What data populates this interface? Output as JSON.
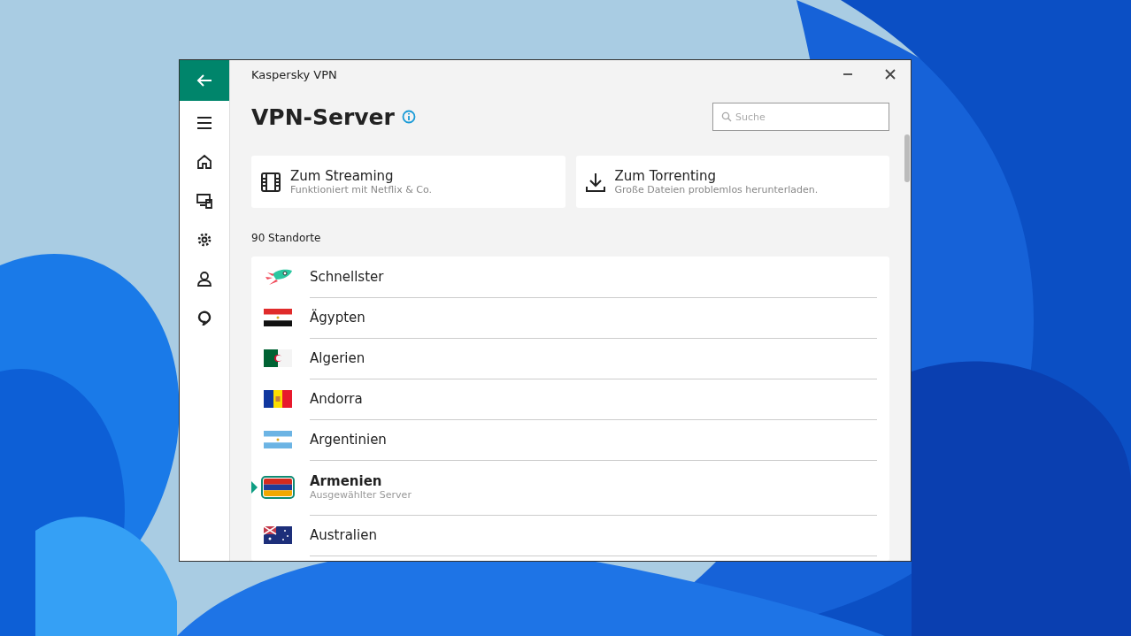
{
  "window": {
    "title": "Kaspersky VPN"
  },
  "page": {
    "title": "VPN-Server"
  },
  "search": {
    "placeholder": "Suche"
  },
  "cards": [
    {
      "kind": "film",
      "title": "Zum Streaming",
      "subtitle": "Funktioniert mit Netflix & Co."
    },
    {
      "kind": "download",
      "title": "Zum Torrenting",
      "subtitle": "Große Dateien problemlos herunterladen."
    }
  ],
  "locations": {
    "count_label": "90 Standorte",
    "rows": [
      {
        "kind": "rocket",
        "name": "Schnellster",
        "selected": false
      },
      {
        "kind": "flag",
        "name": "Ägypten",
        "selected": false
      },
      {
        "kind": "flag",
        "name": "Algerien",
        "selected": false
      },
      {
        "kind": "flag",
        "name": "Andorra",
        "selected": false
      },
      {
        "kind": "flag",
        "name": "Argentinien",
        "selected": false
      },
      {
        "kind": "flag",
        "name": "Armenien",
        "subtitle": "Ausgewählter Server",
        "selected": true
      },
      {
        "kind": "flag",
        "name": "Australien",
        "selected": false
      }
    ]
  }
}
